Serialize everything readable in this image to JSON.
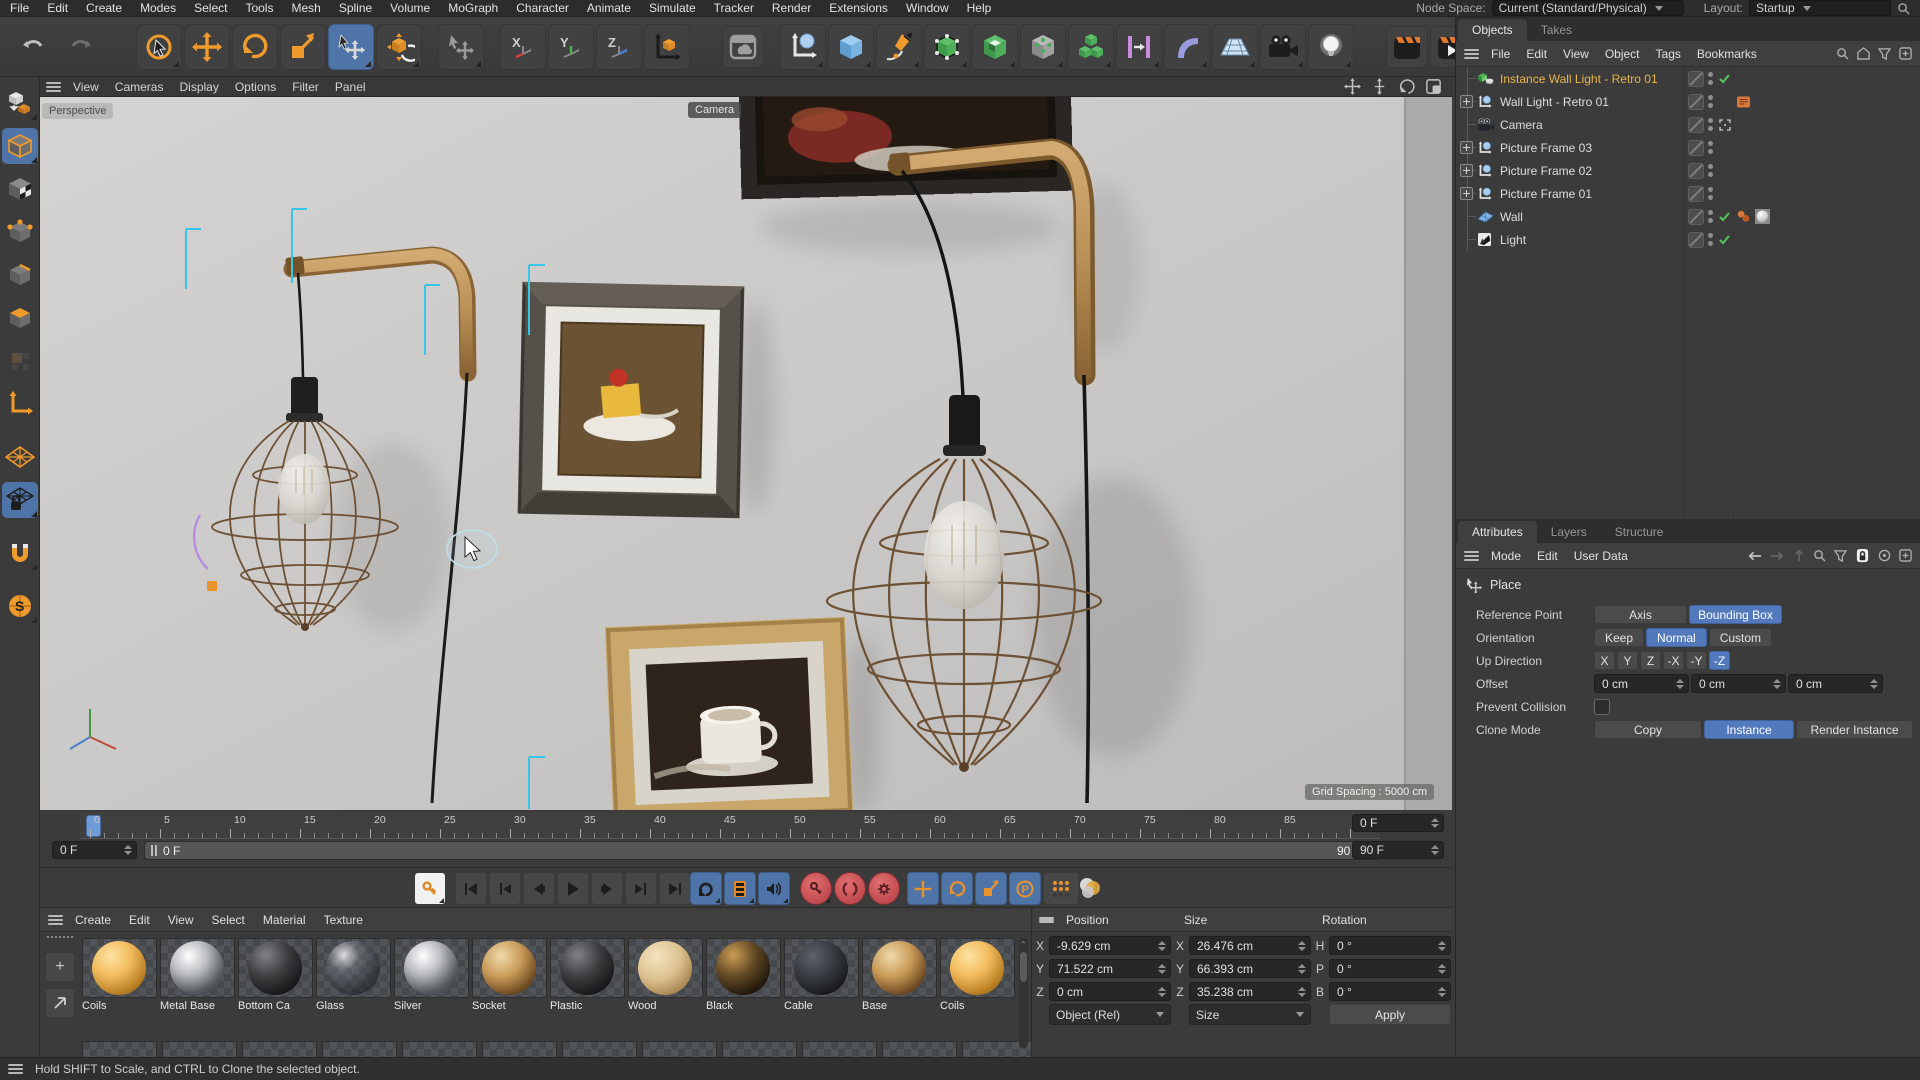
{
  "colors": {
    "accent_orange": "#f09a2e",
    "accent_blue": "#5379bd",
    "selected_text": "#eab64a",
    "panel": "#3b3b3b"
  },
  "menubar": {
    "items": [
      "File",
      "Edit",
      "Create",
      "Modes",
      "Select",
      "Tools",
      "Mesh",
      "Spline",
      "Volume",
      "MoGraph",
      "Character",
      "Animate",
      "Simulate",
      "Tracker",
      "Render",
      "Extensions",
      "Window",
      "Help"
    ],
    "node_space_label": "Node Space:",
    "node_space_value": "Current (Standard/Physical)",
    "layout_label": "Layout:",
    "layout_value": "Startup"
  },
  "viewport": {
    "menu": [
      "View",
      "Cameras",
      "Display",
      "Options",
      "Filter",
      "Panel"
    ],
    "view_label": "Perspective",
    "camera_label": "Camera",
    "grid_spacing": "Grid Spacing : 5000 cm"
  },
  "object_manager": {
    "tabs": [
      "Objects",
      "Takes"
    ],
    "menu": [
      "File",
      "Edit",
      "View",
      "Object",
      "Tags",
      "Bookmarks"
    ],
    "items": [
      {
        "name": "Instance Wall Light - Retro 01",
        "icon": "instance",
        "selected": true,
        "expand": false,
        "check": true,
        "tags": []
      },
      {
        "name": "Wall Light - Retro 01",
        "icon": "null",
        "selected": false,
        "expand": true,
        "check": false,
        "tags": [
          "annotation"
        ]
      },
      {
        "name": "Camera",
        "icon": "camera",
        "selected": false,
        "expand": false,
        "check": false,
        "extra": "viewfinder",
        "tags": []
      },
      {
        "name": "Picture Frame 03",
        "icon": "null",
        "selected": false,
        "expand": true,
        "check": false,
        "tags": []
      },
      {
        "name": "Picture Frame 02",
        "icon": "null",
        "selected": false,
        "expand": true,
        "check": false,
        "tags": []
      },
      {
        "name": "Picture Frame 01",
        "icon": "null",
        "selected": false,
        "expand": true,
        "check": false,
        "tags": []
      },
      {
        "name": "Wall",
        "icon": "plane",
        "selected": false,
        "expand": false,
        "check": true,
        "tags": [
          "material",
          "texture"
        ]
      },
      {
        "name": "Light",
        "icon": "light",
        "selected": false,
        "expand": false,
        "check": true,
        "tags": []
      }
    ]
  },
  "attributes": {
    "tabs": [
      "Attributes",
      "Layers",
      "Structure"
    ],
    "menu": [
      "Mode",
      "Edit",
      "User Data"
    ],
    "section_title": "Place",
    "rows": {
      "reference_point": {
        "label": "Reference Point",
        "options": [
          "Axis",
          "Bounding Box"
        ],
        "selected": "Bounding Box"
      },
      "orientation": {
        "label": "Orientation",
        "options": [
          "Keep",
          "Normal",
          "Custom"
        ],
        "selected": "Normal"
      },
      "up_direction": {
        "label": "Up Direction",
        "options": [
          "X",
          "Y",
          "Z",
          "-X",
          "-Y",
          "-Z"
        ],
        "selected": "-Z"
      },
      "offset": {
        "label": "Offset",
        "values": [
          "0 cm",
          "0 cm",
          "0 cm"
        ]
      },
      "prevent_collision": {
        "label": "Prevent Collision",
        "checked": false
      },
      "clone_mode": {
        "label": "Clone Mode",
        "options": [
          "Copy",
          "Instance",
          "Render Instance"
        ],
        "selected": "Instance"
      }
    }
  },
  "timeline": {
    "ticks": {
      "start": 0,
      "end": 90,
      "major": 5
    },
    "current_frame_field": "0 F",
    "range_start": "0 F",
    "range_end": "90 F",
    "loop_start_field": "0 F",
    "loop_end_field": "90 F"
  },
  "materials": {
    "menu": [
      "Create",
      "Edit",
      "View",
      "Select",
      "Material",
      "Texture"
    ],
    "items": [
      {
        "name": "Coils",
        "type": "gold"
      },
      {
        "name": "Metal Base",
        "type": "silver"
      },
      {
        "name": "Bottom Ca",
        "type": "black"
      },
      {
        "name": "Glass",
        "type": "glass"
      },
      {
        "name": "Silver",
        "type": "silver"
      },
      {
        "name": "Socket",
        "type": "bronze"
      },
      {
        "name": "Plastic",
        "type": "black"
      },
      {
        "name": "Wood",
        "type": "wood"
      },
      {
        "name": "Black",
        "type": "darkgold"
      },
      {
        "name": "Cable",
        "type": "cable"
      },
      {
        "name": "Base",
        "type": "bronze"
      },
      {
        "name": "Coils",
        "type": "gold"
      }
    ]
  },
  "coordinates": {
    "position": {
      "label": "Position",
      "fields": [
        {
          "axis": "X",
          "value": "-9.629 cm"
        },
        {
          "axis": "Y",
          "value": "71.522 cm"
        },
        {
          "axis": "Z",
          "value": "0 cm"
        }
      ],
      "dropdown": "Object (Rel)"
    },
    "size": {
      "label": "Size",
      "fields": [
        {
          "axis": "X",
          "value": "26.476 cm"
        },
        {
          "axis": "Y",
          "value": "66.393 cm"
        },
        {
          "axis": "Z",
          "value": "35.238 cm"
        }
      ],
      "dropdown": "Size"
    },
    "rotation": {
      "label": "Rotation",
      "fields": [
        {
          "axis": "H",
          "value": "0 °"
        },
        {
          "axis": "P",
          "value": "0 °"
        },
        {
          "axis": "B",
          "value": "0 °"
        }
      ],
      "apply": "Apply"
    }
  },
  "status_bar": {
    "text": "Hold SHIFT to Scale, and CTRL to Clone the selected object."
  }
}
